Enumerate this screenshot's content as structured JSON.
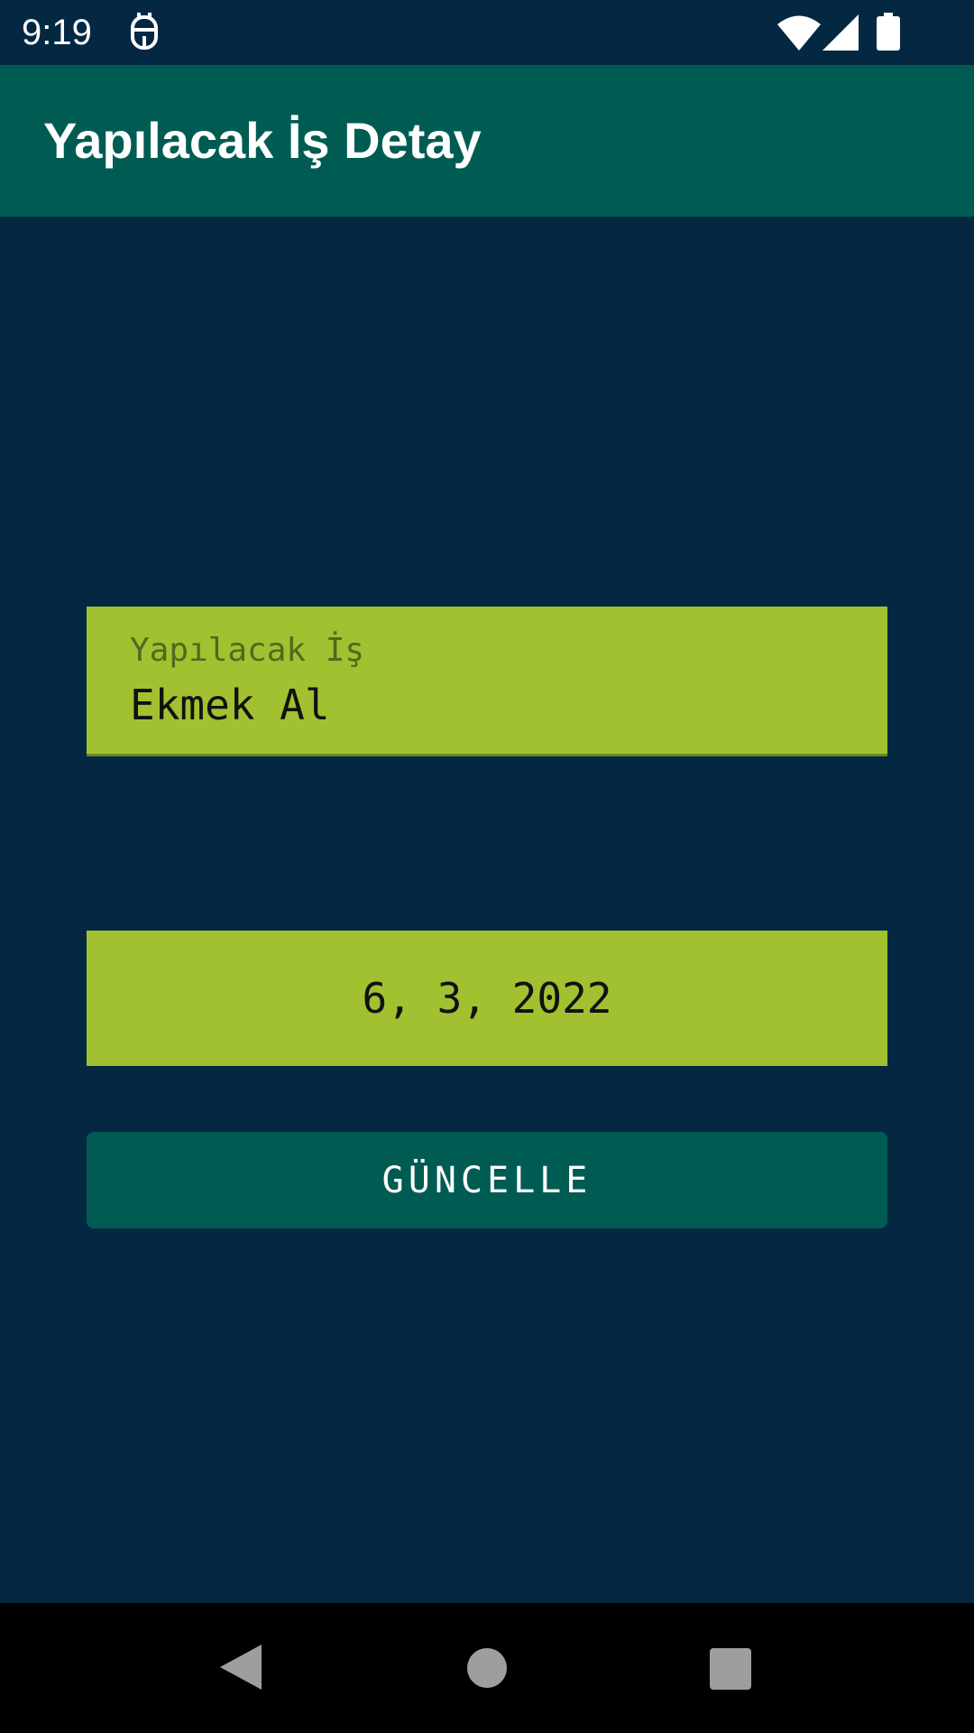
{
  "status_bar": {
    "time": "9:19",
    "icons": [
      "app-notification-icon",
      "wifi-icon",
      "signal-icon",
      "battery-icon"
    ]
  },
  "app_bar": {
    "title": "Yapılacak İş Detay"
  },
  "form": {
    "task_field": {
      "label": "Yapılacak İş",
      "value": "Ekmek Al"
    },
    "date_button": {
      "label": "6, 3, 2022"
    },
    "update_button": {
      "label": "GÜNCELLE"
    }
  },
  "nav_bar": {
    "icons": [
      "back-icon",
      "home-icon",
      "recents-icon"
    ]
  },
  "colors": {
    "background": "#052842",
    "app_bar": "#005c53",
    "field": "#a1c130",
    "button": "#005c53",
    "nav_bar": "#000000"
  }
}
